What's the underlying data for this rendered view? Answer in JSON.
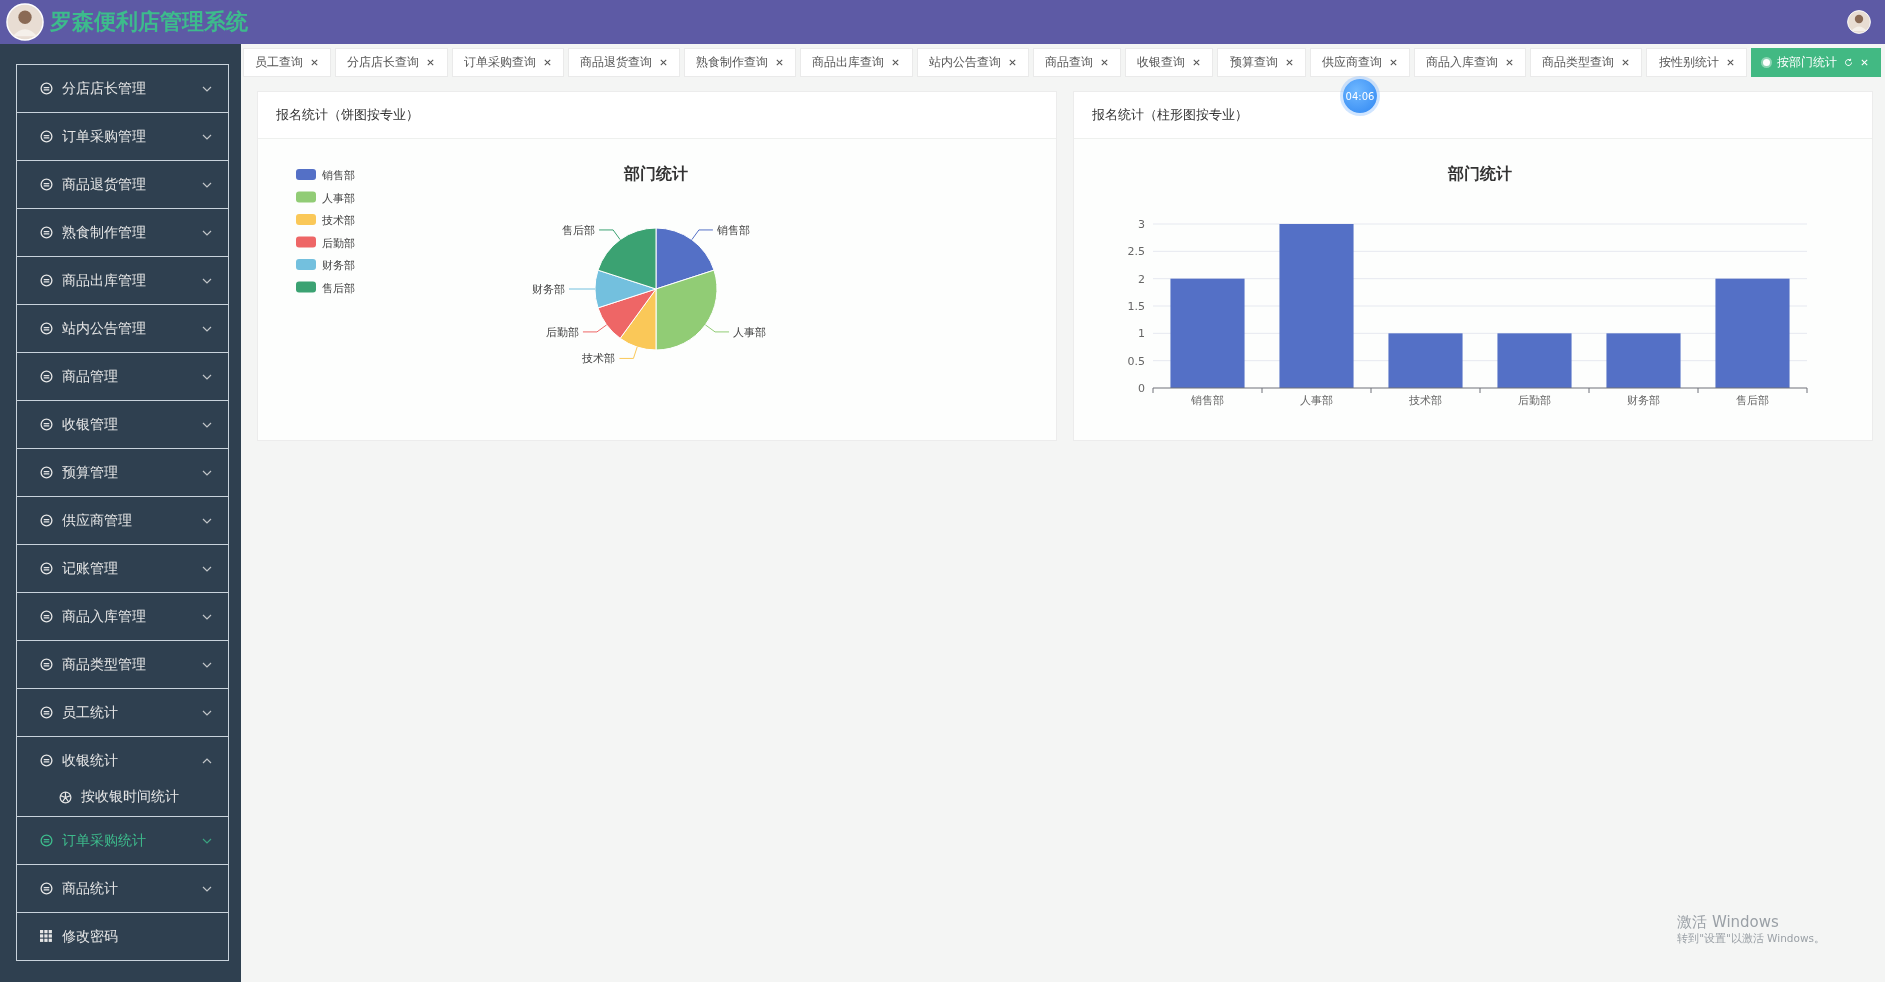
{
  "header": {
    "title": "罗森便利店管理系统"
  },
  "sidebar": {
    "items": [
      {
        "label": "分店店长管理",
        "kind": "menu",
        "expanded": false,
        "highlighted": false
      },
      {
        "label": "订单采购管理",
        "kind": "menu",
        "expanded": false,
        "highlighted": false
      },
      {
        "label": "商品退货管理",
        "kind": "menu",
        "expanded": false,
        "highlighted": false
      },
      {
        "label": "熟食制作管理",
        "kind": "menu",
        "expanded": false,
        "highlighted": false
      },
      {
        "label": "商品出库管理",
        "kind": "menu",
        "expanded": false,
        "highlighted": false
      },
      {
        "label": "站内公告管理",
        "kind": "menu",
        "expanded": false,
        "highlighted": false
      },
      {
        "label": "商品管理",
        "kind": "menu",
        "expanded": false,
        "highlighted": false
      },
      {
        "label": "收银管理",
        "kind": "menu",
        "expanded": false,
        "highlighted": false
      },
      {
        "label": "预算管理",
        "kind": "menu",
        "expanded": false,
        "highlighted": false
      },
      {
        "label": "供应商管理",
        "kind": "menu",
        "expanded": false,
        "highlighted": false
      },
      {
        "label": "记账管理",
        "kind": "menu",
        "expanded": false,
        "highlighted": false
      },
      {
        "label": "商品入库管理",
        "kind": "menu",
        "expanded": false,
        "highlighted": false
      },
      {
        "label": "商品类型管理",
        "kind": "menu",
        "expanded": false,
        "highlighted": false
      },
      {
        "label": "员工统计",
        "kind": "menu",
        "expanded": false,
        "highlighted": false
      },
      {
        "label": "收银统计",
        "kind": "menu",
        "expanded": true,
        "highlighted": false,
        "children": [
          {
            "label": "按收银时间统计"
          }
        ]
      },
      {
        "label": "订单采购统计",
        "kind": "menu",
        "expanded": false,
        "highlighted": true
      },
      {
        "label": "商品统计",
        "kind": "menu",
        "expanded": false,
        "highlighted": false
      },
      {
        "label": "修改密码",
        "kind": "link",
        "highlighted": false
      }
    ]
  },
  "tabs": [
    {
      "label": "员工查询",
      "selected": false
    },
    {
      "label": "分店店长查询",
      "selected": false
    },
    {
      "label": "订单采购查询",
      "selected": false
    },
    {
      "label": "商品退货查询",
      "selected": false
    },
    {
      "label": "熟食制作查询",
      "selected": false
    },
    {
      "label": "商品出库查询",
      "selected": false
    },
    {
      "label": "站内公告查询",
      "selected": false
    },
    {
      "label": "商品查询",
      "selected": false
    },
    {
      "label": "收银查询",
      "selected": false
    },
    {
      "label": "预算查询",
      "selected": false
    },
    {
      "label": "供应商查询",
      "selected": false
    },
    {
      "label": "商品入库查询",
      "selected": false
    },
    {
      "label": "商品类型查询",
      "selected": false
    },
    {
      "label": "按性别统计",
      "selected": false
    },
    {
      "label": "按部门统计",
      "selected": true
    }
  ],
  "timer": "04:06",
  "pie_card": {
    "title": "报名统计（饼图按专业）",
    "legend": [
      {
        "label": "销售部",
        "color": "#5470c6"
      },
      {
        "label": "人事部",
        "color": "#91cc75"
      },
      {
        "label": "技术部",
        "color": "#fac858"
      },
      {
        "label": "后勤部",
        "color": "#ee6666"
      },
      {
        "label": "财务部",
        "color": "#73c0de"
      },
      {
        "label": "售后部",
        "color": "#3ba272"
      }
    ],
    "chart_data": {
      "type": "pie",
      "title": "部门统计",
      "categories": [
        "销售部",
        "人事部",
        "技术部",
        "后勤部",
        "财务部",
        "售后部"
      ],
      "values": [
        20,
        30,
        10,
        10,
        10,
        20
      ]
    }
  },
  "bar_card": {
    "title": "报名统计（柱形图按专业）",
    "chart_data": {
      "type": "bar",
      "title": "部门统计",
      "categories": [
        "销售部",
        "人事部",
        "技术部",
        "后勤部",
        "财务部",
        "售后部"
      ],
      "series": [
        {
          "color": "#5470c6",
          "values": [
            2,
            3,
            1,
            1,
            1,
            2
          ]
        }
      ],
      "grid": true,
      "ylim": [
        0,
        3
      ],
      "yticks": [
        0,
        {
          "value": 0.5,
          "label": "0.5"
        },
        1,
        {
          "value": 1.5,
          "label": "1.5"
        },
        2,
        {
          "value": 2.5,
          "label": "2.5"
        },
        3
      ]
    }
  },
  "os_notice": {
    "title": "激活 Windows",
    "text": "转到\"设置\"以激活 Windows。"
  }
}
